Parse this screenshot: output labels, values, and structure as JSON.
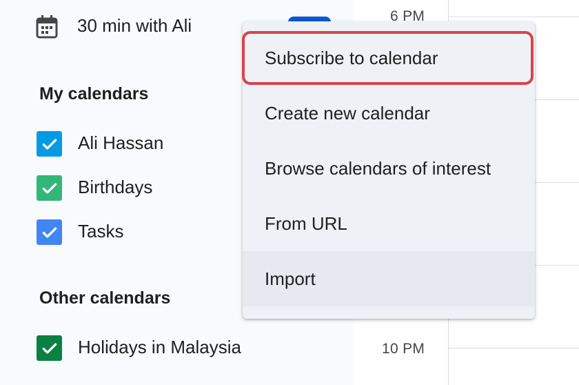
{
  "event": {
    "title": "30 min with Ali"
  },
  "my_calendars": {
    "heading": "My calendars",
    "items": [
      {
        "label": "Ali Hassan",
        "color": "#039be5",
        "checked": true
      },
      {
        "label": "Birthdays",
        "color": "#33b679",
        "checked": true
      },
      {
        "label": "Tasks",
        "color": "#4285f4",
        "checked": true
      }
    ]
  },
  "other_calendars": {
    "heading": "Other calendars",
    "items": [
      {
        "label": "Holidays in Malaysia",
        "color": "#0b8043",
        "checked": true
      }
    ]
  },
  "time_labels": {
    "top": "6 PM",
    "bottom": "10 PM"
  },
  "menu": {
    "items": [
      {
        "label": "Subscribe to calendar",
        "highlighted": true
      },
      {
        "label": "Create new calendar"
      },
      {
        "label": "Browse calendars of interest"
      },
      {
        "label": "From URL"
      },
      {
        "label": "Import",
        "hovered": true
      }
    ]
  },
  "colors": {
    "accent": "#0b57d0",
    "highlight_border": "#d9434f"
  }
}
